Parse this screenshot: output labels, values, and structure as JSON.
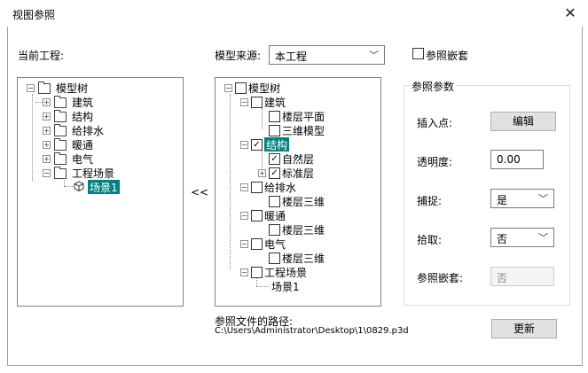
{
  "window": {
    "title": "视图参照",
    "close": "✕"
  },
  "left": {
    "label": "当前工程:",
    "tree": {
      "root": "模型树",
      "items": [
        "建筑",
        "结构",
        "给排水",
        "暖通",
        "电气",
        "工程场景"
      ],
      "scene_child": "场景1"
    }
  },
  "transfer_button": "<<",
  "source": {
    "label": "模型来源:",
    "value": "本工程"
  },
  "embed_checkbox": {
    "label": "参照嵌套",
    "checked": false
  },
  "right_tree": {
    "root": "模型树",
    "build": "建筑",
    "build_children": [
      "楼层平面",
      "三维模型"
    ],
    "struct": "结构",
    "struct_children": [
      "自然层",
      "标准层"
    ],
    "water": "给排水",
    "water_child": "楼层三维",
    "hvac": "暖通",
    "hvac_child": "楼层三维",
    "elec": "电气",
    "elec_child": "楼层三维",
    "scene": "工程场景",
    "scene_child": "场景1"
  },
  "params": {
    "group_title": "参照参数",
    "insert_label": "插入点:",
    "insert_button": "编辑",
    "opacity_label": "透明度:",
    "opacity_value": "0.00",
    "snap_label": "捕捉:",
    "snap_value": "是",
    "pick_label": "拾取:",
    "pick_value": "否",
    "nest_label": "参照嵌套:",
    "nest_value": "否"
  },
  "path": {
    "label": "参照文件的路径:",
    "value": "C:\\Users\\Administrator\\Desktop\\1\\0829.p3d"
  },
  "update_button": "更新"
}
